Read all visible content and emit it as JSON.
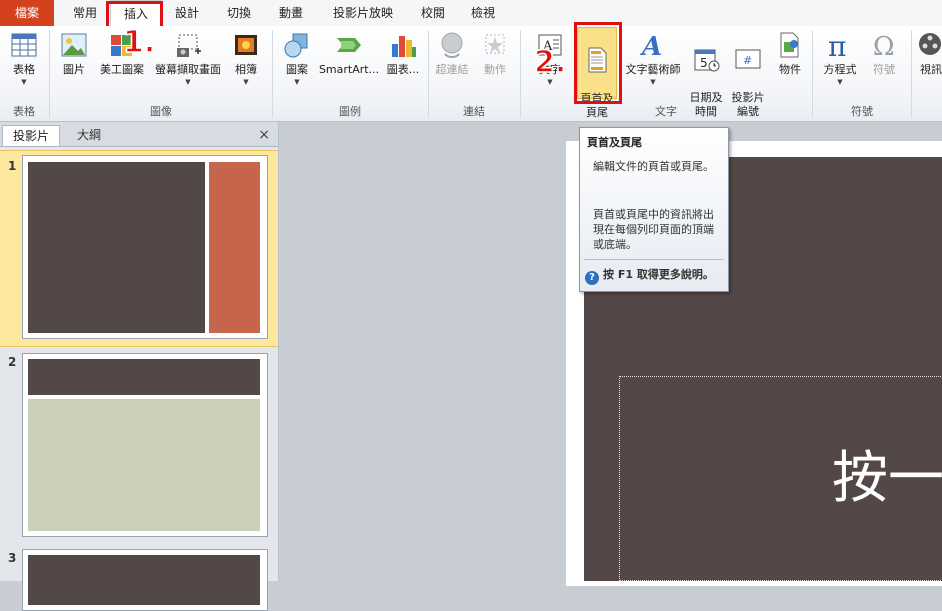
{
  "tabs": [
    "檔案",
    "常用",
    "插入",
    "設計",
    "切換",
    "動畫",
    "投影片放映",
    "校閱",
    "檢視"
  ],
  "steps": {
    "one": "1.",
    "two": "2."
  },
  "ribbon": {
    "groups": {
      "table": "表格",
      "images": "圖像",
      "illustrations": "圖例",
      "links": "連結",
      "text": "文字",
      "symbols": "符號"
    },
    "buttons": {
      "table": "表格",
      "picture": "圖片",
      "clipart": "美工圖案",
      "screenshot": "螢幕擷取畫面",
      "album": "相簿",
      "shapes": "圖案",
      "smartart": "SmartArt...",
      "chart": "圖表...",
      "hyperlink": "超連結",
      "action": "動作",
      "textbox": "文字",
      "header_footer": "頁首及\n頁尾",
      "wordart": "文字藝術師",
      "datetime": "日期及\n時間",
      "slide_number": "投影片\n編號",
      "object": "物件",
      "equation": "方程式",
      "symbol": "符號",
      "video": "視訊"
    }
  },
  "pane": {
    "tab_slides": "投影片",
    "tab_outline": "大綱",
    "close": "×",
    "slide_numbers": [
      "1",
      "2",
      "3"
    ]
  },
  "tooltip": {
    "title": "頁首及頁尾",
    "p1": "編輯文件的頁首或頁尾。",
    "p2": "頁首或頁尾中的資訊將出現在每個列印頁面的頂端或底端。",
    "help_icon": "?",
    "help": "按 F1 取得更多說明。"
  },
  "slide": {
    "text": "按一"
  },
  "colors": {
    "file_tab": "#d3421c",
    "slide_dark": "#534847",
    "accent_orange": "#c7654c",
    "accent_sage": "#cbcfb9",
    "highlight": "#e01010"
  }
}
